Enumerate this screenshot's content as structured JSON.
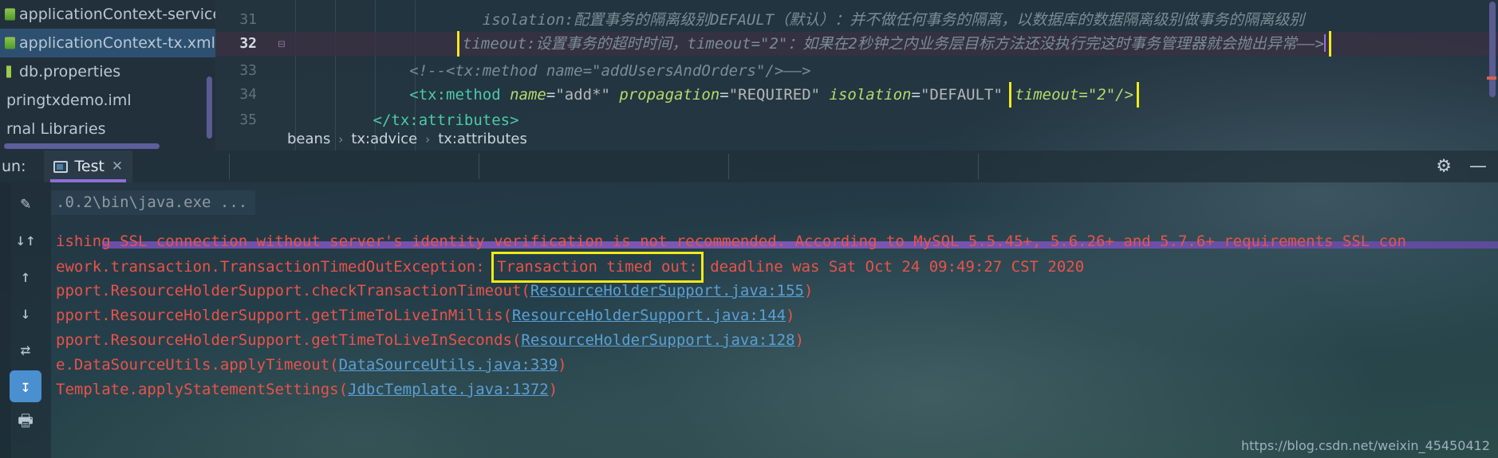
{
  "project_tree": {
    "items": [
      {
        "label": "applicationContext-service.xml",
        "icon": "xml-file-icon",
        "selected": false
      },
      {
        "label": "applicationContext-tx.xml",
        "icon": "xml-file-icon",
        "selected": true
      },
      {
        "label": "db.properties",
        "icon": "properties-file-icon",
        "selected": false
      },
      {
        "label": "pringtxdemo.iml",
        "icon": "module-file-icon",
        "selected": false
      },
      {
        "label": "rnal Libraries",
        "icon": "library-icon",
        "selected": false
      }
    ]
  },
  "editor": {
    "lines": [
      {
        "number": "31",
        "current": false,
        "fold": "",
        "segments": [
          {
            "cls": "tok-comment",
            "text": "                    isolation:配置事务的隔离级别DEFAULT（默认）：并不做任何事务的隔离，以数据库的数据隔离级别做事务的隔离级别"
          }
        ]
      },
      {
        "number": "32",
        "current": true,
        "fold": "minus",
        "highlight": true,
        "highlight_text": "timeout:设置事务的超时时间，timeout=\"2\"：如果在2秒钟之内业务层目标方法还没执行完这时事务管理器就会抛出异常——>"
      },
      {
        "number": "33",
        "current": false,
        "fold": "",
        "segments": [
          {
            "cls": "tok-comment",
            "text": "            <!--<tx:method name=\"addUsersAndOrders\"/>——>"
          }
        ]
      },
      {
        "number": "34",
        "current": false,
        "fold": "",
        "segments": [
          {
            "cls": "tok-tag",
            "text": "            <tx:method "
          },
          {
            "cls": "tok-attr",
            "text": "name"
          },
          {
            "cls": "tok-eq",
            "text": "="
          },
          {
            "cls": "tok-str",
            "text": "\"add*\" "
          },
          {
            "cls": "tok-attr",
            "text": "propagation"
          },
          {
            "cls": "tok-eq",
            "text": "="
          },
          {
            "cls": "tok-str",
            "text": "\"REQUIRED\" "
          },
          {
            "cls": "tok-attr",
            "text": "isolation"
          },
          {
            "cls": "tok-eq",
            "text": "="
          },
          {
            "cls": "tok-str",
            "text": "\"DEFAULT\" "
          }
        ],
        "highlight_tail": "timeout=\"2\"/>"
      },
      {
        "number": "35",
        "current": false,
        "fold": "",
        "segments": [
          {
            "cls": "tok-tag",
            "text": "        </tx:attributes>"
          }
        ]
      }
    ],
    "breadcrumb": [
      "beans",
      "tx:advice",
      "tx:attributes"
    ],
    "breadcrumb_separator": "›"
  },
  "run_window": {
    "label": "un:",
    "tab_label": "Test",
    "tab_close": "✕",
    "gear_icon": "⚙",
    "minimize_icon": "—",
    "side_buttons": [
      {
        "name": "rerun-button",
        "glyph": "✎"
      },
      {
        "name": "sort-button",
        "glyph": "↓↑"
      },
      {
        "name": "up-button",
        "glyph": "↑"
      },
      {
        "name": "down-button",
        "glyph": "↓"
      },
      {
        "name": "wrap-button",
        "glyph": "⇄"
      },
      {
        "name": "export-button",
        "glyph": "↧"
      },
      {
        "name": "print-button",
        "glyph": "🖶"
      }
    ],
    "console_lines": [
      {
        "type": "cmd",
        "text": ".0.2\\bin\\java.exe ..."
      },
      {
        "type": "err",
        "text": "ishing SSL connection without server's identity verification is not recommended. According to MySQL 5.5.45+, 5.6.26+ and 5.7.6+ requirements SSL con"
      },
      {
        "type": "err-highlight",
        "prefix": "ework.transaction.TransactionTimedOutException: ",
        "highlight": "Transaction timed out:",
        "suffix": " deadline was Sat Oct 24 09:49:27 CST 2020"
      },
      {
        "type": "err-link",
        "prefix": "pport.ResourceHolderSupport.checkTransactionTimeout(",
        "link": "ResourceHolderSupport.java:155",
        "suffix": ")"
      },
      {
        "type": "err-link",
        "prefix": "pport.ResourceHolderSupport.getTimeToLiveInMillis(",
        "link": "ResourceHolderSupport.java:144",
        "suffix": ")"
      },
      {
        "type": "err-link",
        "prefix": "pport.ResourceHolderSupport.getTimeToLiveInSeconds(",
        "link": "ResourceHolderSupport.java:128",
        "suffix": ")"
      },
      {
        "type": "err-link",
        "prefix": "e.DataSourceUtils.applyTimeout(",
        "link": "DataSourceUtils.java:339",
        "suffix": ")"
      },
      {
        "type": "err-link",
        "prefix": "Template.applyStatementSettings(",
        "link": "JdbcTemplate.java:1372",
        "suffix": ")"
      }
    ]
  },
  "watermark": "https://blog.csdn.net/weixin_45450412",
  "colors": {
    "highlight_box": "#f2ea17",
    "error_text": "#e8534a",
    "link": "#5b9fd4",
    "accent_purple": "#8f6fd6",
    "tab_accent": "#4a8fd0"
  }
}
